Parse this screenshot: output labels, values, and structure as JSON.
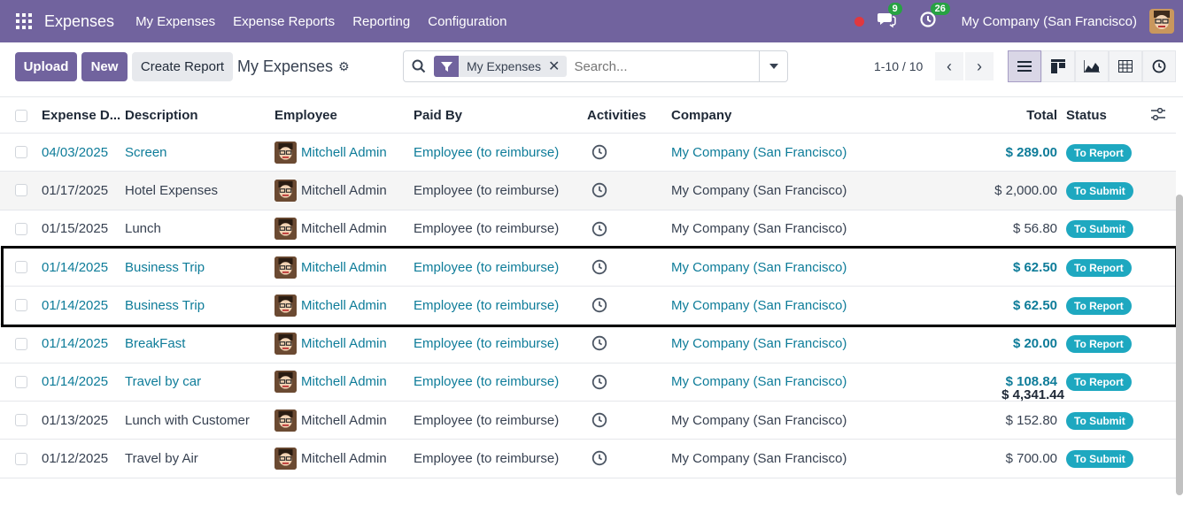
{
  "navbar": {
    "app_name": "Expenses",
    "menu": [
      "My Expenses",
      "Expense Reports",
      "Reporting",
      "Configuration"
    ],
    "messages_count": "9",
    "activities_count": "26",
    "company": "My Company (San Francisco)",
    "bg_color": "#71639e"
  },
  "control": {
    "upload_label": "Upload",
    "new_label": "New",
    "create_report_label": "Create Report",
    "breadcrumb": "My Expenses",
    "facet_label": "My Expenses",
    "search_placeholder": "Search...",
    "pager": "1-10 / 10"
  },
  "columns": {
    "date": "Expense D...",
    "description": "Description",
    "employee": "Employee",
    "paid_by": "Paid By",
    "activities": "Activities",
    "company": "Company",
    "total": "Total",
    "status": "Status"
  },
  "rows": [
    {
      "date": "04/03/2025",
      "description": "Screen",
      "employee": "Mitchell Admin",
      "paid_by": "Employee (to reimburse)",
      "company": "My Company (San Francisco)",
      "total": "$ 289.00",
      "status": "To Report"
    },
    {
      "date": "01/17/2025",
      "description": "Hotel Expenses",
      "employee": "Mitchell Admin",
      "paid_by": "Employee (to reimburse)",
      "company": "My Company (San Francisco)",
      "total": "$ 2,000.00",
      "status": "To Submit"
    },
    {
      "date": "01/15/2025",
      "description": "Lunch",
      "employee": "Mitchell Admin",
      "paid_by": "Employee (to reimburse)",
      "company": "My Company (San Francisco)",
      "total": "$ 56.80",
      "status": "To Submit"
    },
    {
      "date": "01/14/2025",
      "description": "Business Trip",
      "employee": "Mitchell Admin",
      "paid_by": "Employee (to reimburse)",
      "company": "My Company (San Francisco)",
      "total": "$ 62.50",
      "status": "To Report"
    },
    {
      "date": "01/14/2025",
      "description": "Business Trip",
      "employee": "Mitchell Admin",
      "paid_by": "Employee (to reimburse)",
      "company": "My Company (San Francisco)",
      "total": "$ 62.50",
      "status": "To Report"
    },
    {
      "date": "01/14/2025",
      "description": "BreakFast",
      "employee": "Mitchell Admin",
      "paid_by": "Employee (to reimburse)",
      "company": "My Company (San Francisco)",
      "total": "$ 20.00",
      "status": "To Report"
    },
    {
      "date": "01/14/2025",
      "description": "Travel by car",
      "employee": "Mitchell Admin",
      "paid_by": "Employee (to reimburse)",
      "company": "My Company (San Francisco)",
      "total": "$ 108.84",
      "status": "To Report"
    },
    {
      "date": "01/13/2025",
      "description": "Lunch with Customer",
      "employee": "Mitchell Admin",
      "paid_by": "Employee (to reimburse)",
      "company": "My Company (San Francisco)",
      "total": "$ 152.80",
      "status": "To Submit"
    },
    {
      "date": "01/12/2025",
      "description": "Travel by Air",
      "employee": "Mitchell Admin",
      "paid_by": "Employee (to reimburse)",
      "company": "My Company (San Francisco)",
      "total": "$ 700.00",
      "status": "To Submit"
    }
  ],
  "footer": {
    "grand_total": "$ 4,341.44"
  },
  "colors": {
    "link": "#0e7c99",
    "status_badge": "#1ea8c0",
    "primary": "#71639e"
  }
}
